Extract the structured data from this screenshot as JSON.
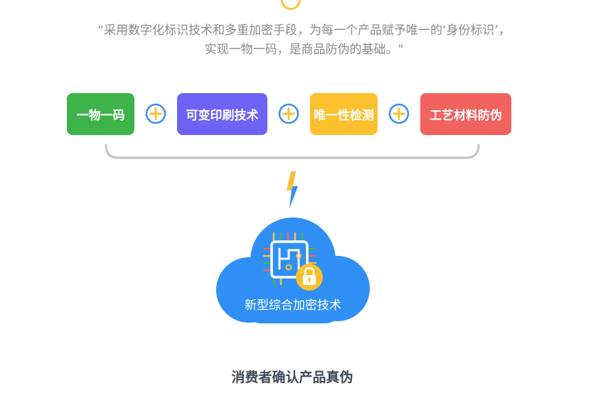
{
  "intro": {
    "line1": "“采用数字化标识技术和多重加密手段，为每一个产品赋予唯一的‘身份标识’，",
    "line2": "实现一物一码，是商品防伪的基础。\""
  },
  "features": [
    {
      "label": "一物一码",
      "color": "#3db34a"
    },
    {
      "label": "可变印刷技术",
      "color": "#6c63f5"
    },
    {
      "label": "唯一性检测",
      "color": "#fbc02d"
    },
    {
      "label": "工艺材料防伪",
      "color": "#f2625f"
    }
  ],
  "colors": {
    "plus_ring": "#3f8ef5",
    "plus_cross": "#f5c23b",
    "bracket": "#c2c2c2",
    "cloud": "#2f8ff5",
    "lock": "#fbc02d"
  },
  "icons": [
    "plus-icon",
    "lightning-icon",
    "cloud-icon",
    "chip-icon",
    "lock-icon"
  ],
  "cloud": {
    "label": "新型综合加密技术"
  },
  "result": {
    "label": "消费者确认产品真伪"
  }
}
